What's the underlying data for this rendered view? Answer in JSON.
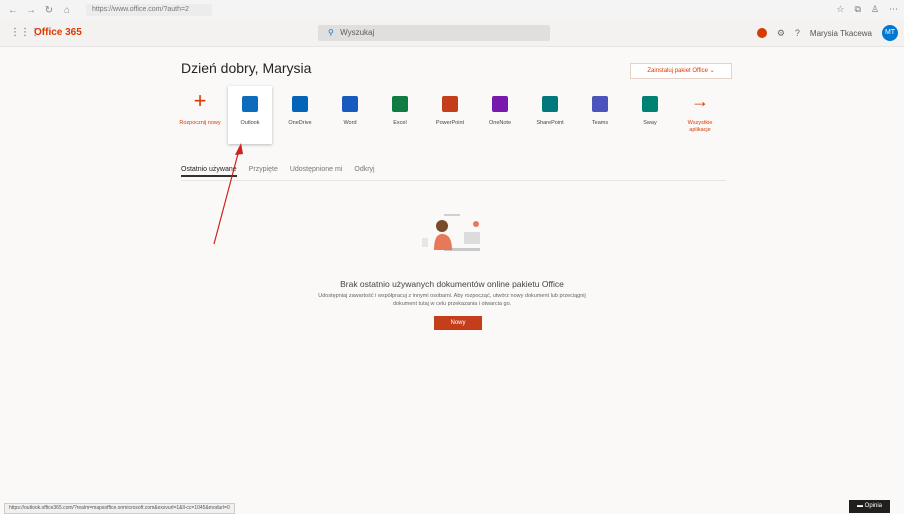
{
  "browser": {
    "url": "https://www.office.com/?auth=2",
    "back": "←",
    "forward": "→",
    "refresh": "↻",
    "home": "⌂"
  },
  "header": {
    "brand": "Office 365",
    "search_placeholder": "Wyszukaj",
    "help": "?",
    "settings": "⚙",
    "user_name": "Marysia Tkacewa",
    "user_initials": "MT"
  },
  "greeting": "Dzień dobry, Marysia",
  "install_office": "Zainstaluj pakiet Office ⌄",
  "apps": [
    {
      "label": "Rozpocznij nowy",
      "icon": "plus-icon"
    },
    {
      "label": "Outlook",
      "icon": "outlook-icon",
      "color": "#0f6cbd"
    },
    {
      "label": "OneDrive",
      "icon": "onedrive-icon",
      "color": "#0364b8"
    },
    {
      "label": "Word",
      "icon": "word-icon",
      "color": "#185abd"
    },
    {
      "label": "Excel",
      "icon": "excel-icon",
      "color": "#107c41"
    },
    {
      "label": "PowerPoint",
      "icon": "powerpoint-icon",
      "color": "#c43e1c"
    },
    {
      "label": "OneNote",
      "icon": "onenote-icon",
      "color": "#7719aa"
    },
    {
      "label": "SharePoint",
      "icon": "sharepoint-icon",
      "color": "#03787c"
    },
    {
      "label": "Teams",
      "icon": "teams-icon",
      "color": "#4b53bc"
    },
    {
      "label": "Sway",
      "icon": "sway-icon",
      "color": "#008272"
    },
    {
      "label": "Wszystkie aplikacje",
      "icon": "arrow-right-icon"
    }
  ],
  "tabs": [
    "Ostatnio używane",
    "Przypięte",
    "Udostępnione mi",
    "Odkryj"
  ],
  "empty_state": {
    "title": "Brak ostatnio używanych dokumentów online pakietu Office",
    "subtitle": "Udostępniaj zawartość i współpracuj z innymi osobami. Aby rozpocząć, utwórz nowy dokument lub przeciągnij dokument tutaj w celu przekazania i otwarcia go.",
    "new_button": "Nowy"
  },
  "status_url": "https://outlook.office365.com/?realm=mapsoffice.onmicrosoft.com&exsvurl=1&ll-cc=1045&modurl=0",
  "feedback": "Opinia"
}
